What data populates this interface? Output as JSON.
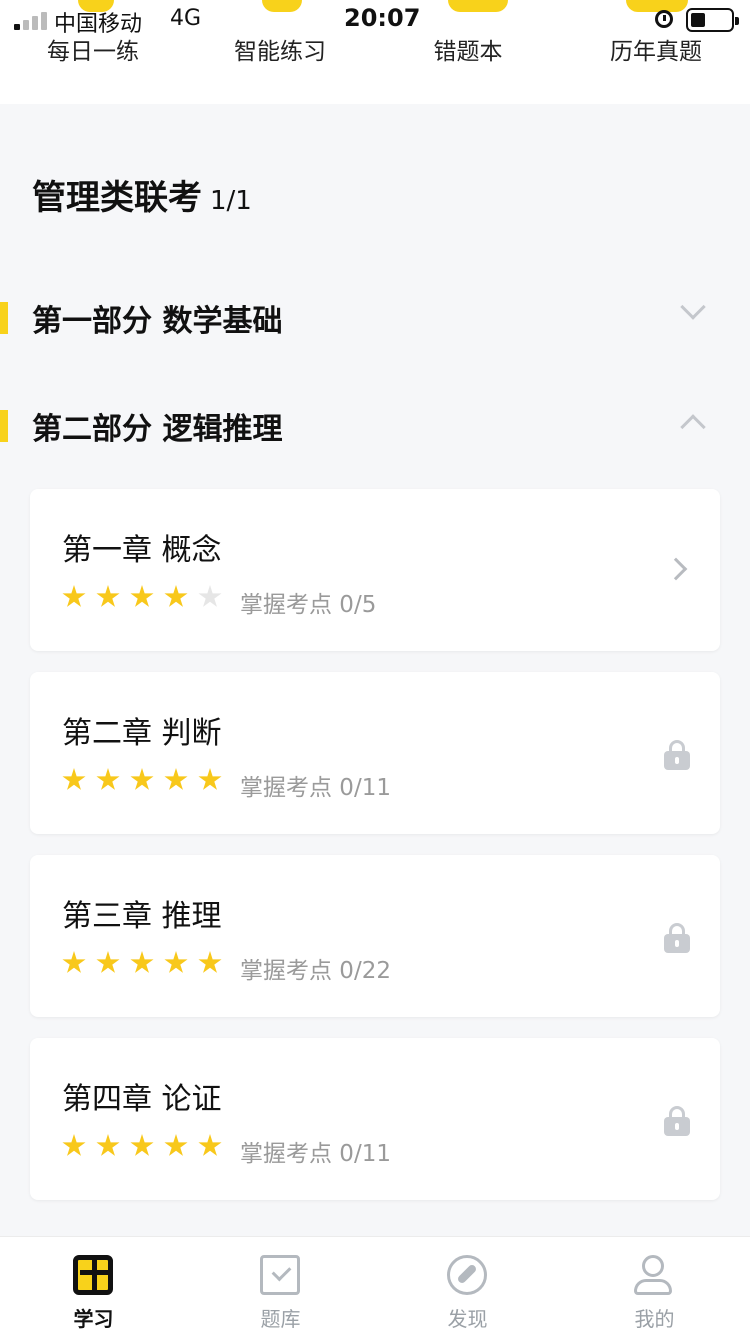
{
  "status_bar": {
    "carrier": "中国移动",
    "network": "4G",
    "time": "20:07",
    "alarm_icon": "alarm-icon",
    "battery_icon": "battery-icon"
  },
  "quick_nav": [
    {
      "label": "每日一练",
      "icon": "daily-practice-icon"
    },
    {
      "label": "智能练习",
      "icon": "smart-practice-icon"
    },
    {
      "label": "错题本",
      "icon": "mistakes-book-icon"
    },
    {
      "label": "历年真题",
      "icon": "past-papers-icon"
    }
  ],
  "exam": {
    "title": "管理类联考",
    "progress": "1/1"
  },
  "sections": [
    {
      "title": "第一部分 数学基础",
      "expanded": false
    },
    {
      "title": "第二部分 逻辑推理",
      "expanded": true
    }
  ],
  "chapters": [
    {
      "title": "第一章 概念",
      "stars_filled": 4,
      "stars_total": 5,
      "meta": "掌握考点 0/5",
      "locked": false
    },
    {
      "title": "第二章 判断",
      "stars_filled": 5,
      "stars_total": 5,
      "meta": "掌握考点 0/11",
      "locked": true
    },
    {
      "title": "第三章 推理",
      "stars_filled": 5,
      "stars_total": 5,
      "meta": "掌握考点 0/22",
      "locked": true
    },
    {
      "title": "第四章 论证",
      "stars_filled": 5,
      "stars_total": 5,
      "meta": "掌握考点 0/11",
      "locked": true
    }
  ],
  "tab_bar": [
    {
      "label": "学习",
      "icon": "study-icon",
      "active": true
    },
    {
      "label": "题库",
      "icon": "question-bank-icon",
      "active": false
    },
    {
      "label": "发现",
      "icon": "discover-icon",
      "active": false
    },
    {
      "label": "我的",
      "icon": "profile-icon",
      "active": false
    }
  ],
  "colors": {
    "accent": "#f8d21b",
    "star": "#f8c81b",
    "muted_text": "#9a9a9a",
    "background": "#f6f7f9"
  }
}
